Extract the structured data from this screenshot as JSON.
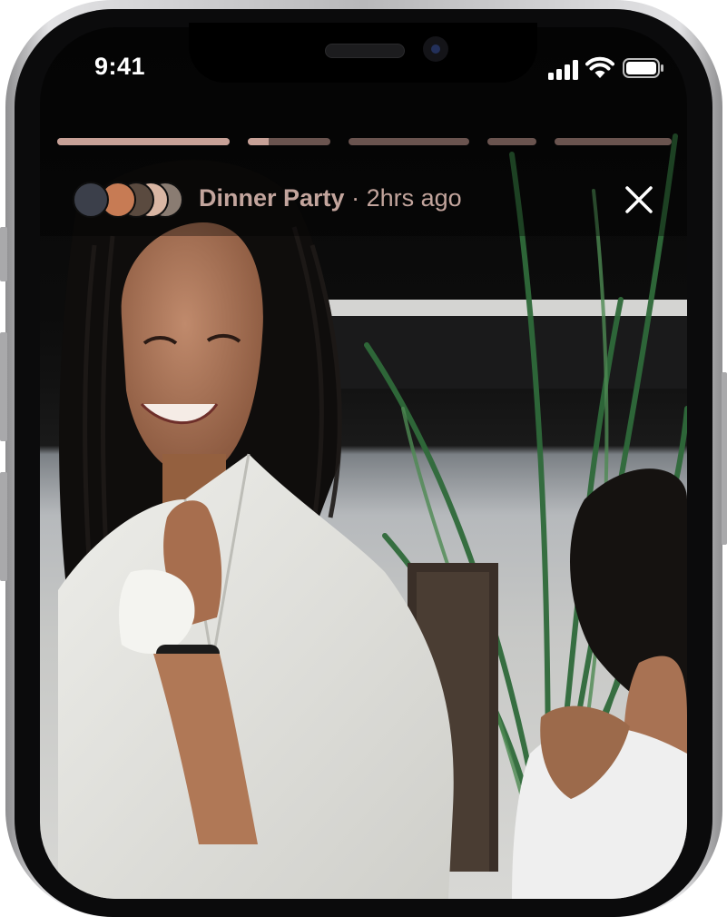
{
  "status_bar": {
    "time": "9:41"
  },
  "story": {
    "progress": [
      1.0,
      0.25,
      0.0,
      0.0,
      0.0
    ],
    "title": "Dinner Party",
    "separator": "·",
    "timestamp": "2hrs ago"
  },
  "avatars": [
    {
      "name": "avatar-1",
      "color": "#3b3f4a"
    },
    {
      "name": "avatar-2",
      "color": "#c77b54"
    },
    {
      "name": "avatar-3",
      "color": "#5a4a3f"
    },
    {
      "name": "avatar-4",
      "color": "#d9b6a3"
    },
    {
      "name": "avatar-5",
      "color": "#8a7c72"
    }
  ],
  "colors": {
    "title_text": "#c3a59d",
    "progress_track": "#be968c",
    "progress_fill": "#c7a197"
  },
  "icons": [
    "signal-icon",
    "wifi-icon",
    "battery-icon",
    "close-icon"
  ]
}
